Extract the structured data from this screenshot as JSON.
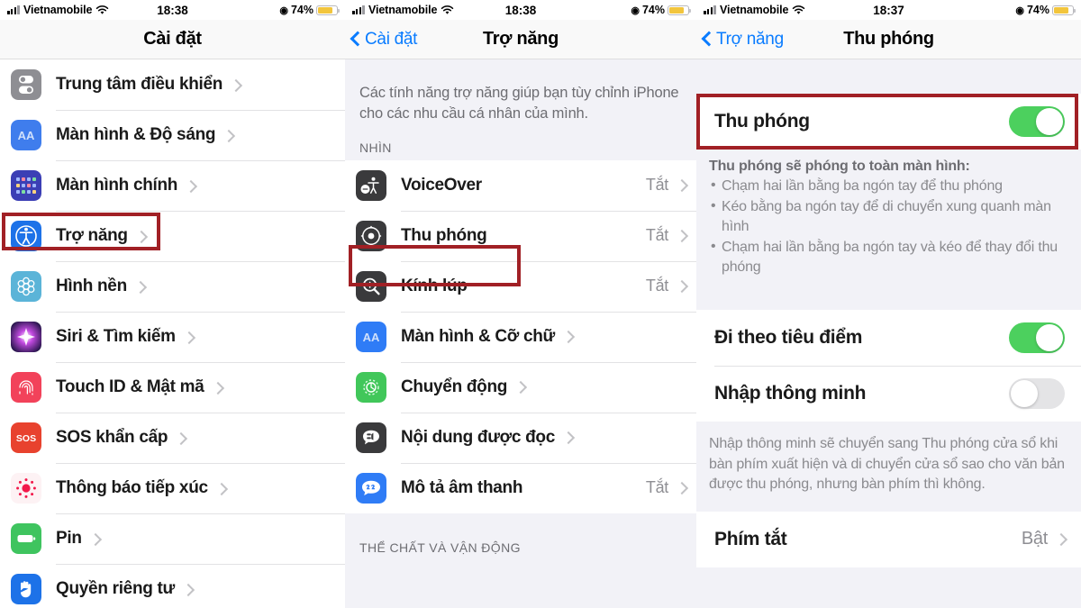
{
  "statusbars": {
    "carrier": "Vietnamobile",
    "time_1": "18:38",
    "time_2": "18:38",
    "time_3": "18:37",
    "battery_pct": "74%"
  },
  "colors": {
    "accent_blue": "#0a7cff",
    "toggle_on_green": "#4cd05e",
    "toggle_off_gray": "#e4e4e6",
    "highlight_red": "#a12025",
    "battery_yellow": "#f2c53d",
    "secondary_text": "#8e8e93"
  },
  "panel1": {
    "nav": {
      "title": "Cài đặt"
    },
    "items": [
      {
        "label": "Trung tâm điều khiển",
        "icon": "control-center-icon",
        "value": ""
      },
      {
        "label": "Màn hình & Độ sáng",
        "icon": "display-brightness-icon",
        "value": ""
      },
      {
        "label": "Màn hình chính",
        "icon": "home-screen-icon",
        "value": ""
      },
      {
        "label": "Trợ năng",
        "icon": "accessibility-icon",
        "value": ""
      },
      {
        "label": "Hình nền",
        "icon": "wallpaper-icon",
        "value": ""
      },
      {
        "label": "Siri & Tìm kiếm",
        "icon": "siri-icon",
        "value": ""
      },
      {
        "label": "Touch ID & Mật mã",
        "icon": "touch-id-icon",
        "value": ""
      },
      {
        "label": "SOS khẩn cấp",
        "icon": "sos-icon",
        "value": ""
      },
      {
        "label": "Thông báo tiếp xúc",
        "icon": "exposure-notification-icon",
        "value": ""
      },
      {
        "label": "Pin",
        "icon": "battery-icon",
        "value": ""
      },
      {
        "label": "Quyền riêng tư",
        "icon": "privacy-hand-icon",
        "value": ""
      }
    ]
  },
  "panel2": {
    "nav": {
      "back": "Cài đặt",
      "title": "Trợ năng"
    },
    "blurb": "Các tính năng trợ năng giúp bạn tùy chỉnh iPhone cho các nhu cầu cá nhân của mình.",
    "section_vision": "NHÌN",
    "items": [
      {
        "label": "VoiceOver",
        "icon": "voiceover-icon",
        "value": "Tắt"
      },
      {
        "label": "Thu phóng",
        "icon": "zoom-icon",
        "value": "Tắt"
      },
      {
        "label": "Kính lúp",
        "icon": "magnifier-icon",
        "value": "Tắt"
      },
      {
        "label": "Màn hình & Cỡ chữ",
        "icon": "display-text-size-icon",
        "value": ""
      },
      {
        "label": "Chuyển động",
        "icon": "motion-icon",
        "value": ""
      },
      {
        "label": "Nội dung được đọc",
        "icon": "spoken-content-icon",
        "value": ""
      },
      {
        "label": "Mô tả âm thanh",
        "icon": "audio-descriptions-icon",
        "value": "Tắt"
      }
    ],
    "section_physical": "THỂ CHẤT VÀ VẬN ĐỘNG"
  },
  "panel3": {
    "nav": {
      "back": "Trợ năng",
      "title": "Thu phóng"
    },
    "zoom_row": {
      "label": "Thu phóng",
      "toggle": "on"
    },
    "zoom_note_title": "Thu phóng sẽ phóng to toàn màn hình:",
    "zoom_note_bullets": [
      "Chạm hai lần bằng ba ngón tay để thu phóng",
      "Kéo bằng ba ngón tay để di chuyển xung quanh màn hình",
      "Chạm hai lần bằng ba ngón tay và kéo để thay đổi thu phóng"
    ],
    "follow_focus": {
      "label": "Đi theo tiêu điểm",
      "toggle": "on"
    },
    "smart_typing": {
      "label": "Nhập thông minh",
      "toggle": "off"
    },
    "smart_typing_note": "Nhập thông minh sẽ chuyển sang Thu phóng cửa sổ khi bàn phím xuất hiện và di chuyển cửa sổ sao cho văn bản được thu phóng, nhưng bàn phím thì không.",
    "shortcut_row": {
      "label": "Phím tắt",
      "value": "Bật"
    }
  }
}
